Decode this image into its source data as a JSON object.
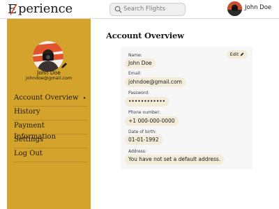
{
  "header": {
    "logo_initial": "E",
    "logo_rest": "perience",
    "search_placeholder": "Search Flights",
    "user_name": "John Doe"
  },
  "sidebar": {
    "name": "John Doe",
    "email": "johndoe@gmail.com",
    "items": [
      {
        "label": "Account Overview"
      },
      {
        "label": "History"
      },
      {
        "label": "Payment Information"
      },
      {
        "label": "Settings"
      },
      {
        "label": "Log Out"
      }
    ],
    "active_chevron": "▸"
  },
  "main": {
    "title": "Account Overview",
    "edit_label": "Edit",
    "fields": [
      {
        "label": "Name:",
        "value": "John Doe"
      },
      {
        "label": "Email:",
        "value": "johndoe@gmail.com"
      },
      {
        "label": "Password:",
        "value": "••••••••••••"
      },
      {
        "label": "Phone number:",
        "value": "+1 000-000-0000"
      },
      {
        "label": "Date of birth:",
        "value": "01-01-1992"
      },
      {
        "label": "Address:",
        "value": "You have not set a default address."
      }
    ]
  },
  "colors": {
    "sidebar": "#d4a32b",
    "pill": "#f2ecd8",
    "card": "#f6f6f6",
    "logo_accent": "#d9452b"
  }
}
